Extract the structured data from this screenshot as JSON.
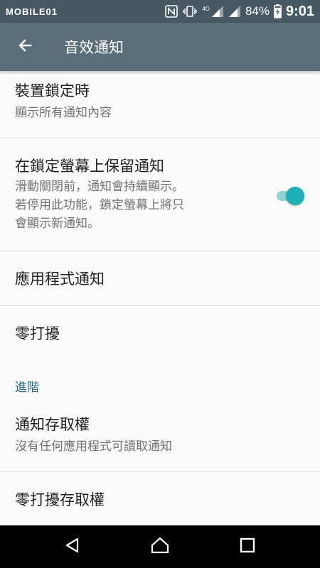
{
  "status_bar": {
    "watermark": "MOBILE01",
    "network_label": "4G",
    "battery_percent": "84%",
    "time": "9:01",
    "icons": [
      "nfc-icon",
      "vibrate-icon",
      "signal-icon",
      "battery-charging-icon"
    ]
  },
  "app_bar": {
    "back_icon": "arrow-left-icon",
    "title": "音效通知"
  },
  "settings": [
    {
      "title": "裝置鎖定時",
      "summary": "顯示所有通知內容"
    },
    {
      "title": "在鎖定螢幕上保留通知",
      "summary_lines": [
        "滑動關閉前，通知會持續顯示。",
        "若停用此功能，鎖定螢幕上將只",
        "會顯示新通知。"
      ],
      "toggle_on": true
    },
    {
      "title": "應用程式通知"
    },
    {
      "title": "零打擾"
    }
  ],
  "section_header": "進階",
  "advanced": [
    {
      "title": "通知存取權",
      "summary": "沒有任何應用程式可讀取通知"
    },
    {
      "title": "零打擾存取權"
    }
  ],
  "colors": {
    "status_bar": "#485963",
    "app_bar": "#5a6e7a",
    "accent": "#1fb1b8",
    "section_header": "#2a6b8a"
  },
  "nav_bar": [
    "back-triangle-icon",
    "home-icon",
    "recents-icon"
  ]
}
